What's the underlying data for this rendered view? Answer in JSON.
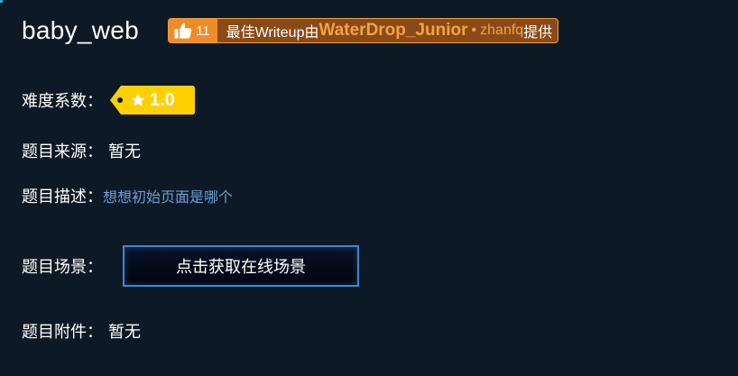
{
  "challenge": {
    "title": "baby_web"
  },
  "writeup": {
    "like_count": "11",
    "prefix": "最佳Writeup由",
    "author": "WaterDrop_Junior",
    "separator": "•",
    "uploader": "zhanfq",
    "suffix": "提供"
  },
  "difficulty": {
    "label": "难度系数：",
    "value": "1.0",
    "color": "#ffd000"
  },
  "source": {
    "label": "题目来源：",
    "value": "暂无"
  },
  "description": {
    "label": "题目描述：",
    "value": "想想初始页面是哪个"
  },
  "scene": {
    "label": "题目场景：",
    "button_label": "点击获取在线场景"
  },
  "attachment": {
    "label": "题目附件：",
    "value": "暂无"
  },
  "colors": {
    "background": "#0d1925",
    "accent_orange": "#f08c28",
    "link_blue": "#6d9fd6",
    "button_border": "#3f86d4"
  }
}
